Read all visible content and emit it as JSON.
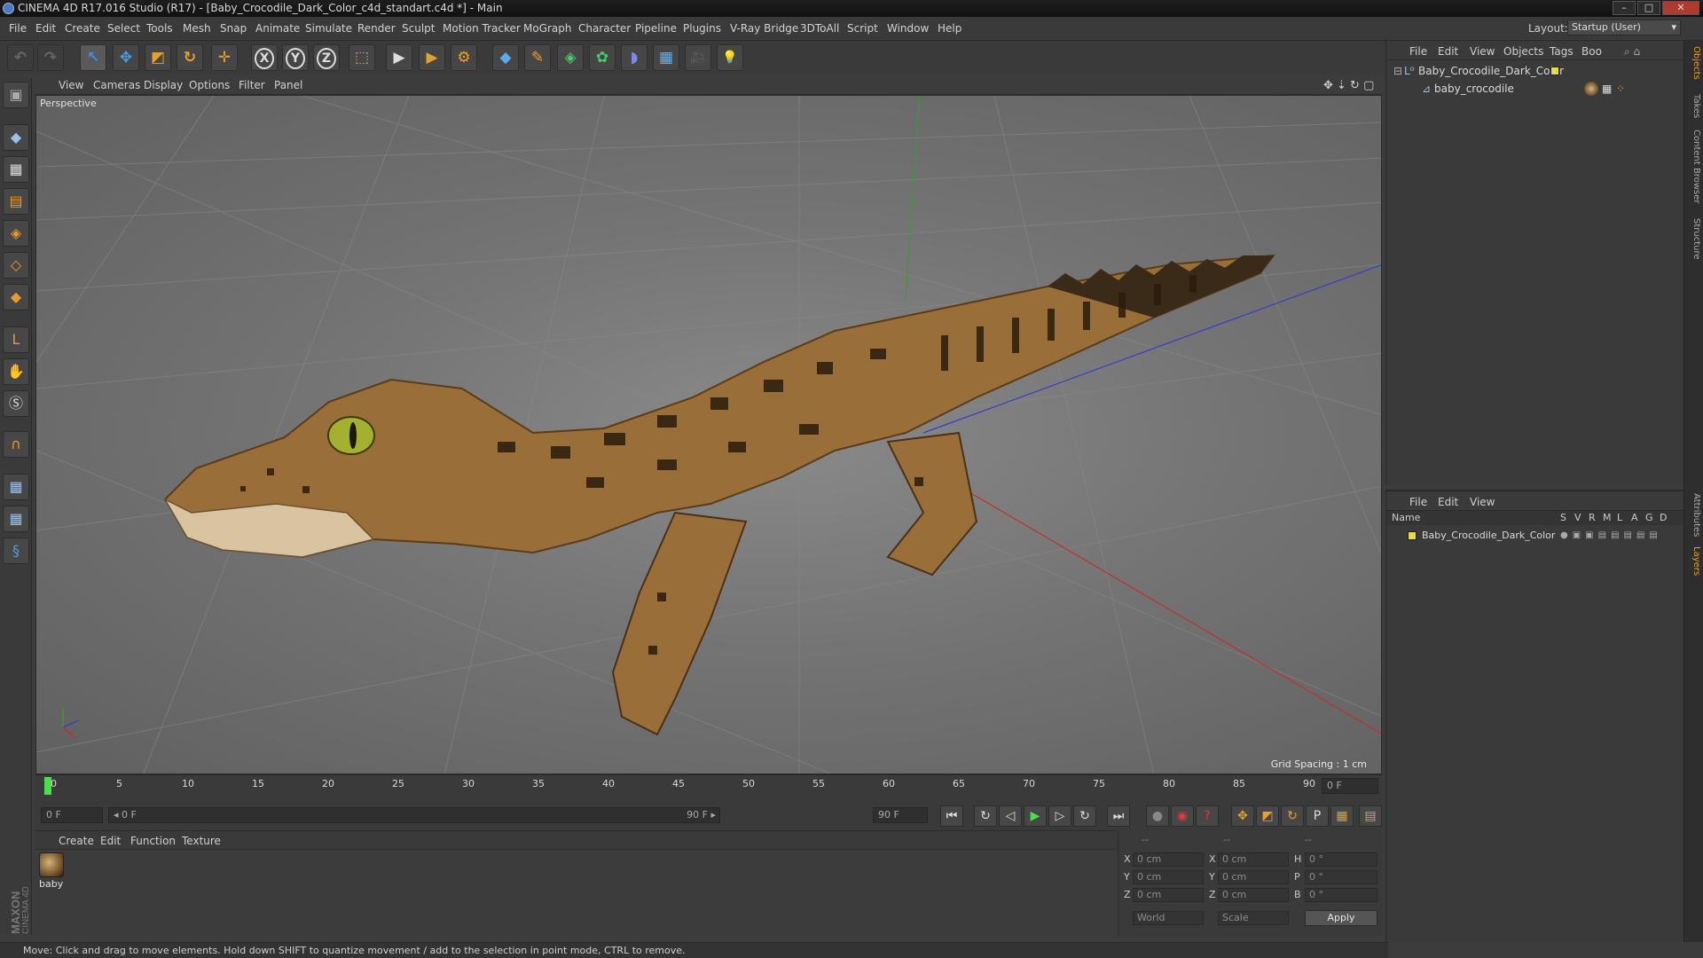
{
  "window": {
    "title": "CINEMA 4D R17.016 Studio (R17) - [Baby_Crocodile_Dark_Color_c4d_standart.c4d *] - Main",
    "minimize": "–",
    "maximize": "□",
    "close": "✕"
  },
  "menubar": {
    "items": [
      "File",
      "Edit",
      "Create",
      "Select",
      "Tools",
      "Mesh",
      "Snap",
      "Animate",
      "Simulate",
      "Render",
      "Sculpt",
      "Motion Tracker",
      "MoGraph",
      "Character",
      "Pipeline",
      "Plugins",
      "V-Ray Bridge",
      "3DToAll",
      "Script",
      "Window",
      "Help"
    ],
    "layout_label": "Layout:",
    "layout_value": "Startup (User)"
  },
  "toolbar": {
    "undo": "↶",
    "redo": "↷",
    "select": "↖",
    "move": "✥",
    "scale": "◩",
    "rotate": "↻",
    "add": "✛",
    "x_axis": "X",
    "y_axis": "Y",
    "z_axis": "Z",
    "coord": "⬚",
    "render_view": "▶",
    "render_settings": "⚙",
    "cube": "◆",
    "pen": "✎",
    "subdiv": "◈",
    "cloner": "✿",
    "deformer": "◗",
    "floor": "▦",
    "camera": "🎥",
    "light": "💡"
  },
  "viewport": {
    "menu": [
      "View",
      "Cameras",
      "Display",
      "Options",
      "Filter",
      "Panel"
    ],
    "label": "Perspective",
    "grid_spacing": "Grid Spacing : 1 cm"
  },
  "timeline": {
    "ticks": [
      "0",
      "5",
      "10",
      "15",
      "20",
      "25",
      "30",
      "35",
      "40",
      "45",
      "50",
      "55",
      "60",
      "65",
      "70",
      "75",
      "80",
      "85",
      "90"
    ],
    "current_frame": "0 F",
    "start_frame": "0 F",
    "range_start": "◂ 0 F",
    "range_end": "90 F ▸",
    "end_frame": "90 F",
    "end_frame2": "90 F",
    "position_fraction": 0
  },
  "transport": {
    "first": "⏮",
    "prev_key": "◁",
    "prev": "◀",
    "play": "▶",
    "next": "▷",
    "next_key": "↻",
    "last": "⏭",
    "rec": "●",
    "autokey": "◉",
    "help": "?",
    "move": "✥",
    "scale": "◩",
    "rotate": "↻",
    "param": "P",
    "grid": "▦",
    "film": "▤"
  },
  "materials": {
    "menu": [
      "Create",
      "Edit",
      "Function",
      "Texture"
    ],
    "items": [
      {
        "label": "baby"
      }
    ]
  },
  "coordinates": {
    "header": [
      "--",
      "--",
      "--"
    ],
    "rows": [
      {
        "a": "X",
        "av": "0 cm",
        "b": "X",
        "bv": "0 cm",
        "c": "H",
        "cv": "0 °"
      },
      {
        "a": "Y",
        "av": "0 cm",
        "b": "Y",
        "bv": "0 cm",
        "c": "P",
        "cv": "0 °"
      },
      {
        "a": "Z",
        "av": "0 cm",
        "b": "Z",
        "bv": "0 cm",
        "c": "B",
        "cv": "0 °"
      }
    ],
    "world": "World",
    "scale": "Scale",
    "apply": "Apply"
  },
  "objects": {
    "menu": [
      "File",
      "Edit",
      "View",
      "Objects",
      "Tags",
      "Boo"
    ],
    "rows": [
      {
        "name": "Baby_Crocodile_Dark_Color"
      },
      {
        "name": "baby_crocodile"
      }
    ]
  },
  "layers": {
    "menu": [
      "File",
      "Edit",
      "View"
    ],
    "columns": [
      "Name",
      "S",
      "V",
      "R",
      "M",
      "L",
      "A",
      "G",
      "D"
    ],
    "rows": [
      {
        "name": "Baby_Crocodile_Dark_Color"
      }
    ]
  },
  "right_tabs": [
    "Objects",
    "Takes",
    "Content Browser",
    "Structure",
    "Attributes",
    "Layers"
  ],
  "status": "Move: Click and drag to move elements. Hold down SHIFT to quantize movement / add to the selection in point mode, CTRL to remove.",
  "brand": {
    "line1": "MAXON",
    "line2": "CINEMA 4D"
  },
  "colors": {
    "accent": "#e89a2c",
    "layer_yellow": "#e8d84a",
    "axis_x": "#c03030",
    "axis_y": "#3a9a3a",
    "axis_z": "#3a3ac8"
  }
}
